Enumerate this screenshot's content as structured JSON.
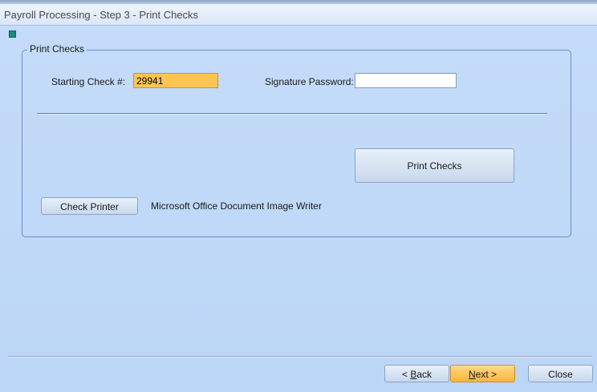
{
  "window": {
    "title": "Payroll Processing - Step 3 - Print Checks"
  },
  "group": {
    "legend": "Print Checks"
  },
  "check_number": {
    "label": "Starting Check #:",
    "value": "29941"
  },
  "signature": {
    "label": "Signature Password:",
    "value": ""
  },
  "actions": {
    "print_checks": "Print Checks",
    "check_printer": "Check Printer",
    "printer_name": "Microsoft Office Document Image Writer"
  },
  "footer": {
    "back_prefix": "< ",
    "back_key": "B",
    "back_rest": "ack",
    "next_key": "N",
    "next_rest": "ext >",
    "close": "Close"
  },
  "colors": {
    "background": "#c2dbf8",
    "highlight_field": "#fbc553",
    "next_button": "#fbb53a",
    "group_border": "#6f8fbf"
  }
}
